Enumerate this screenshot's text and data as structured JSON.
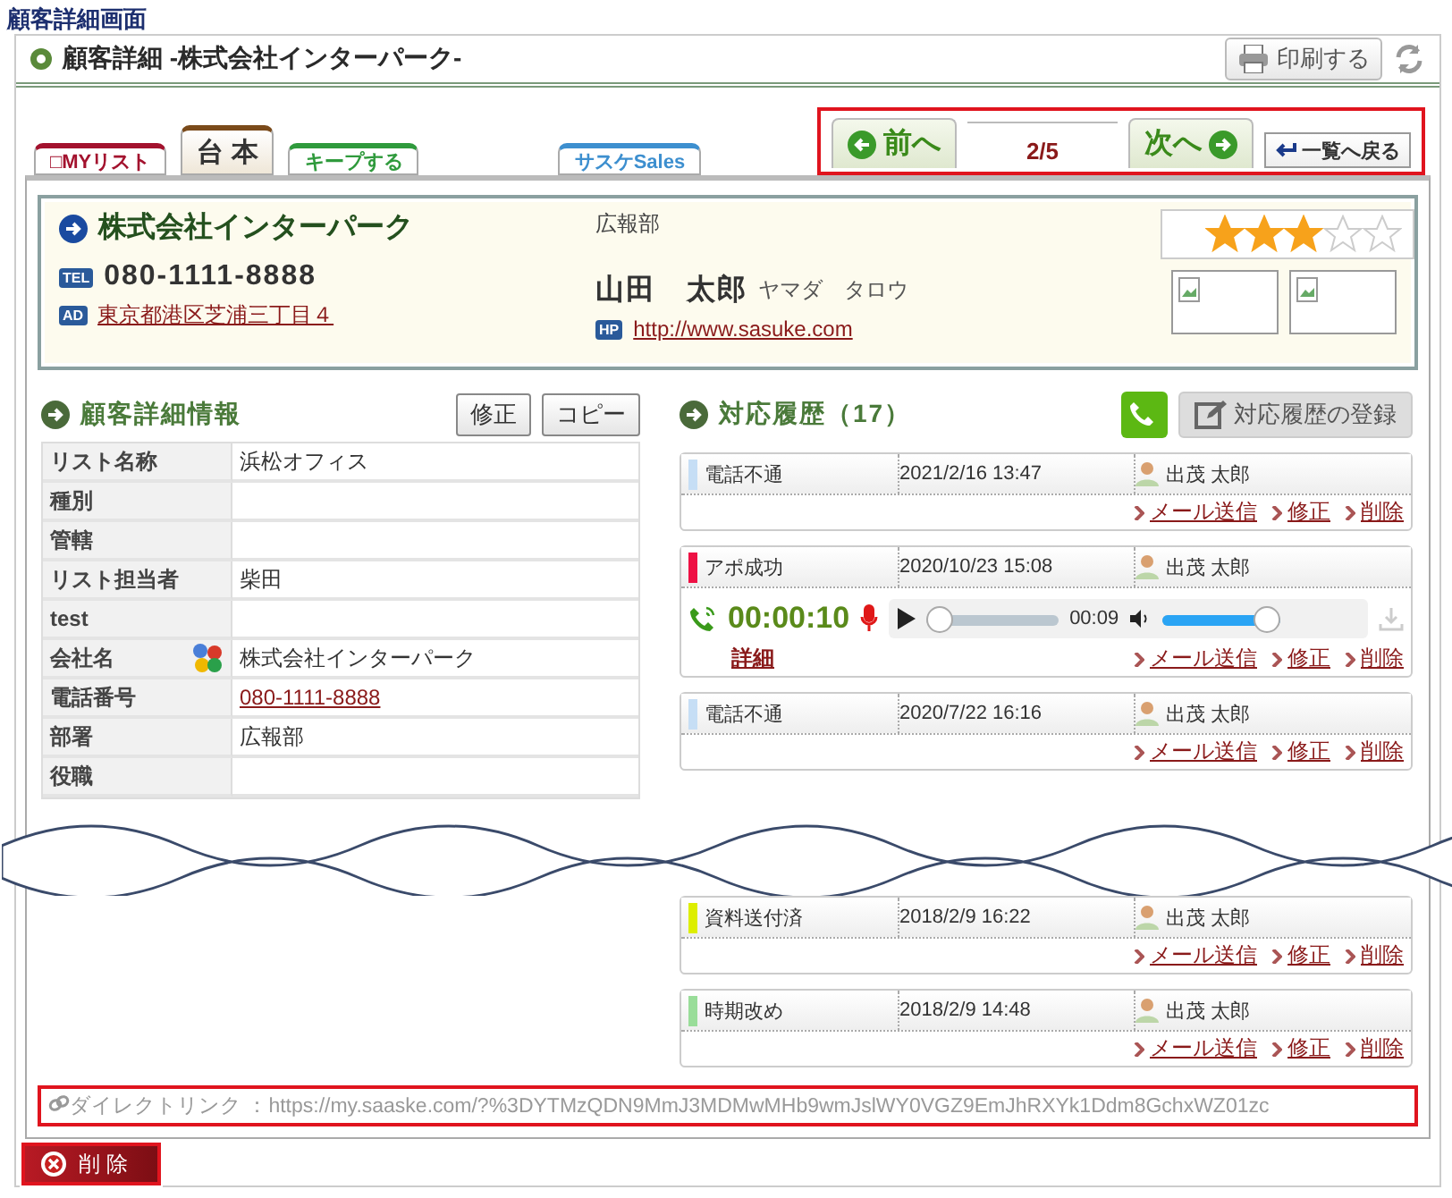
{
  "page_title": "顧客詳細画面",
  "header": {
    "title": "顧客詳細 -株式会社インターパーク-",
    "print_button": "印刷する"
  },
  "tabs": [
    {
      "label": "□MYリスト",
      "color": "#a3122e"
    },
    {
      "label": "台 本",
      "color": "#7a4a1a"
    },
    {
      "label": "キープする",
      "color": "#2f9a3c"
    },
    {
      "label": "サスケSales",
      "color": "#3d8fcf"
    }
  ],
  "nav": {
    "prev": "前へ",
    "page": "2/5",
    "next": "次へ",
    "back": "一覧へ戻る"
  },
  "customer": {
    "company": "株式会社インターパーク",
    "department": "広報部",
    "tel_badge": "TEL",
    "tel": "080-1111-8888",
    "address_badge": "AD",
    "address": "東京都港区芝浦三丁目４",
    "name": "山田　太郎",
    "kana": "ヤマダ　タロウ",
    "url_badge": "HP",
    "url": "http://www.sasuke.com",
    "stars": 3
  },
  "details": {
    "title": "顧客詳細情報",
    "buttons": [
      "修正",
      "コピー"
    ],
    "rows": [
      {
        "label": "リスト名称",
        "value": "浜松オフィス",
        "kind": "plain"
      },
      {
        "label": "種別",
        "kind": "plain"
      },
      {
        "label": "管轄",
        "kind": "plain"
      },
      {
        "label": "リスト担当者",
        "value": "柴田",
        "kind": "plain"
      },
      {
        "label": "test",
        "kind": "plain"
      },
      {
        "label": "会社名",
        "value": "株式会社インターパーク",
        "kind": "company"
      },
      {
        "label": "電話番号",
        "value": "080-1111-8888",
        "kind": "link"
      },
      {
        "label": "部署",
        "value": "広報部",
        "kind": "plain"
      },
      {
        "label": "役職",
        "kind": "plain"
      }
    ]
  },
  "history": {
    "title": "対応履歴（17）",
    "register_button": "対応履歴の登録",
    "items_top": [
      {
        "kind": "plain",
        "status": "電話不通",
        "color": "#c6def5",
        "date": "2021/2/16 13:47",
        "user": "出茂 太郎",
        "actions": [
          "メール送信",
          "修正",
          "削除"
        ]
      },
      {
        "kind": "call",
        "status": "アポ成功",
        "color": "#ee1144",
        "date": "2020/10/23 15:08",
        "user": "出茂 太郎",
        "duration": "00:00:10",
        "time": "00:09",
        "position": {
          "level": 0
        },
        "volume": {
          "level": 1
        },
        "detail_link": "詳細",
        "actions": [
          "メール送信",
          "修正",
          "削除"
        ]
      },
      {
        "kind": "plain",
        "status": "電話不通",
        "color": "#c6def5",
        "date": "2020/7/22 16:16",
        "user": "出茂 太郎",
        "actions": [
          "メール送信",
          "修正",
          "削除"
        ]
      }
    ],
    "items_bottom": [
      {
        "kind": "plain",
        "status": "資料送付済",
        "color": "#ddee00",
        "date": "2018/2/9 16:22",
        "user": "出茂 太郎",
        "actions": [
          "メール送信",
          "修正",
          "削除"
        ]
      },
      {
        "kind": "plain",
        "status": "時期改め",
        "color": "#99dd99",
        "date": "2018/2/9 14:48",
        "user": "出茂 太郎",
        "actions": [
          "メール送信",
          "修正",
          "削除"
        ]
      }
    ]
  },
  "direct_link": "ダイレクトリンク ：https://my.saaske.com/?%3DYTMzQDN9MmJ3MDMwMHb9wmJslWY0VGZ9EmJhRXYk1Ddm8GchxWZ01zc",
  "delete_button": "削 除"
}
